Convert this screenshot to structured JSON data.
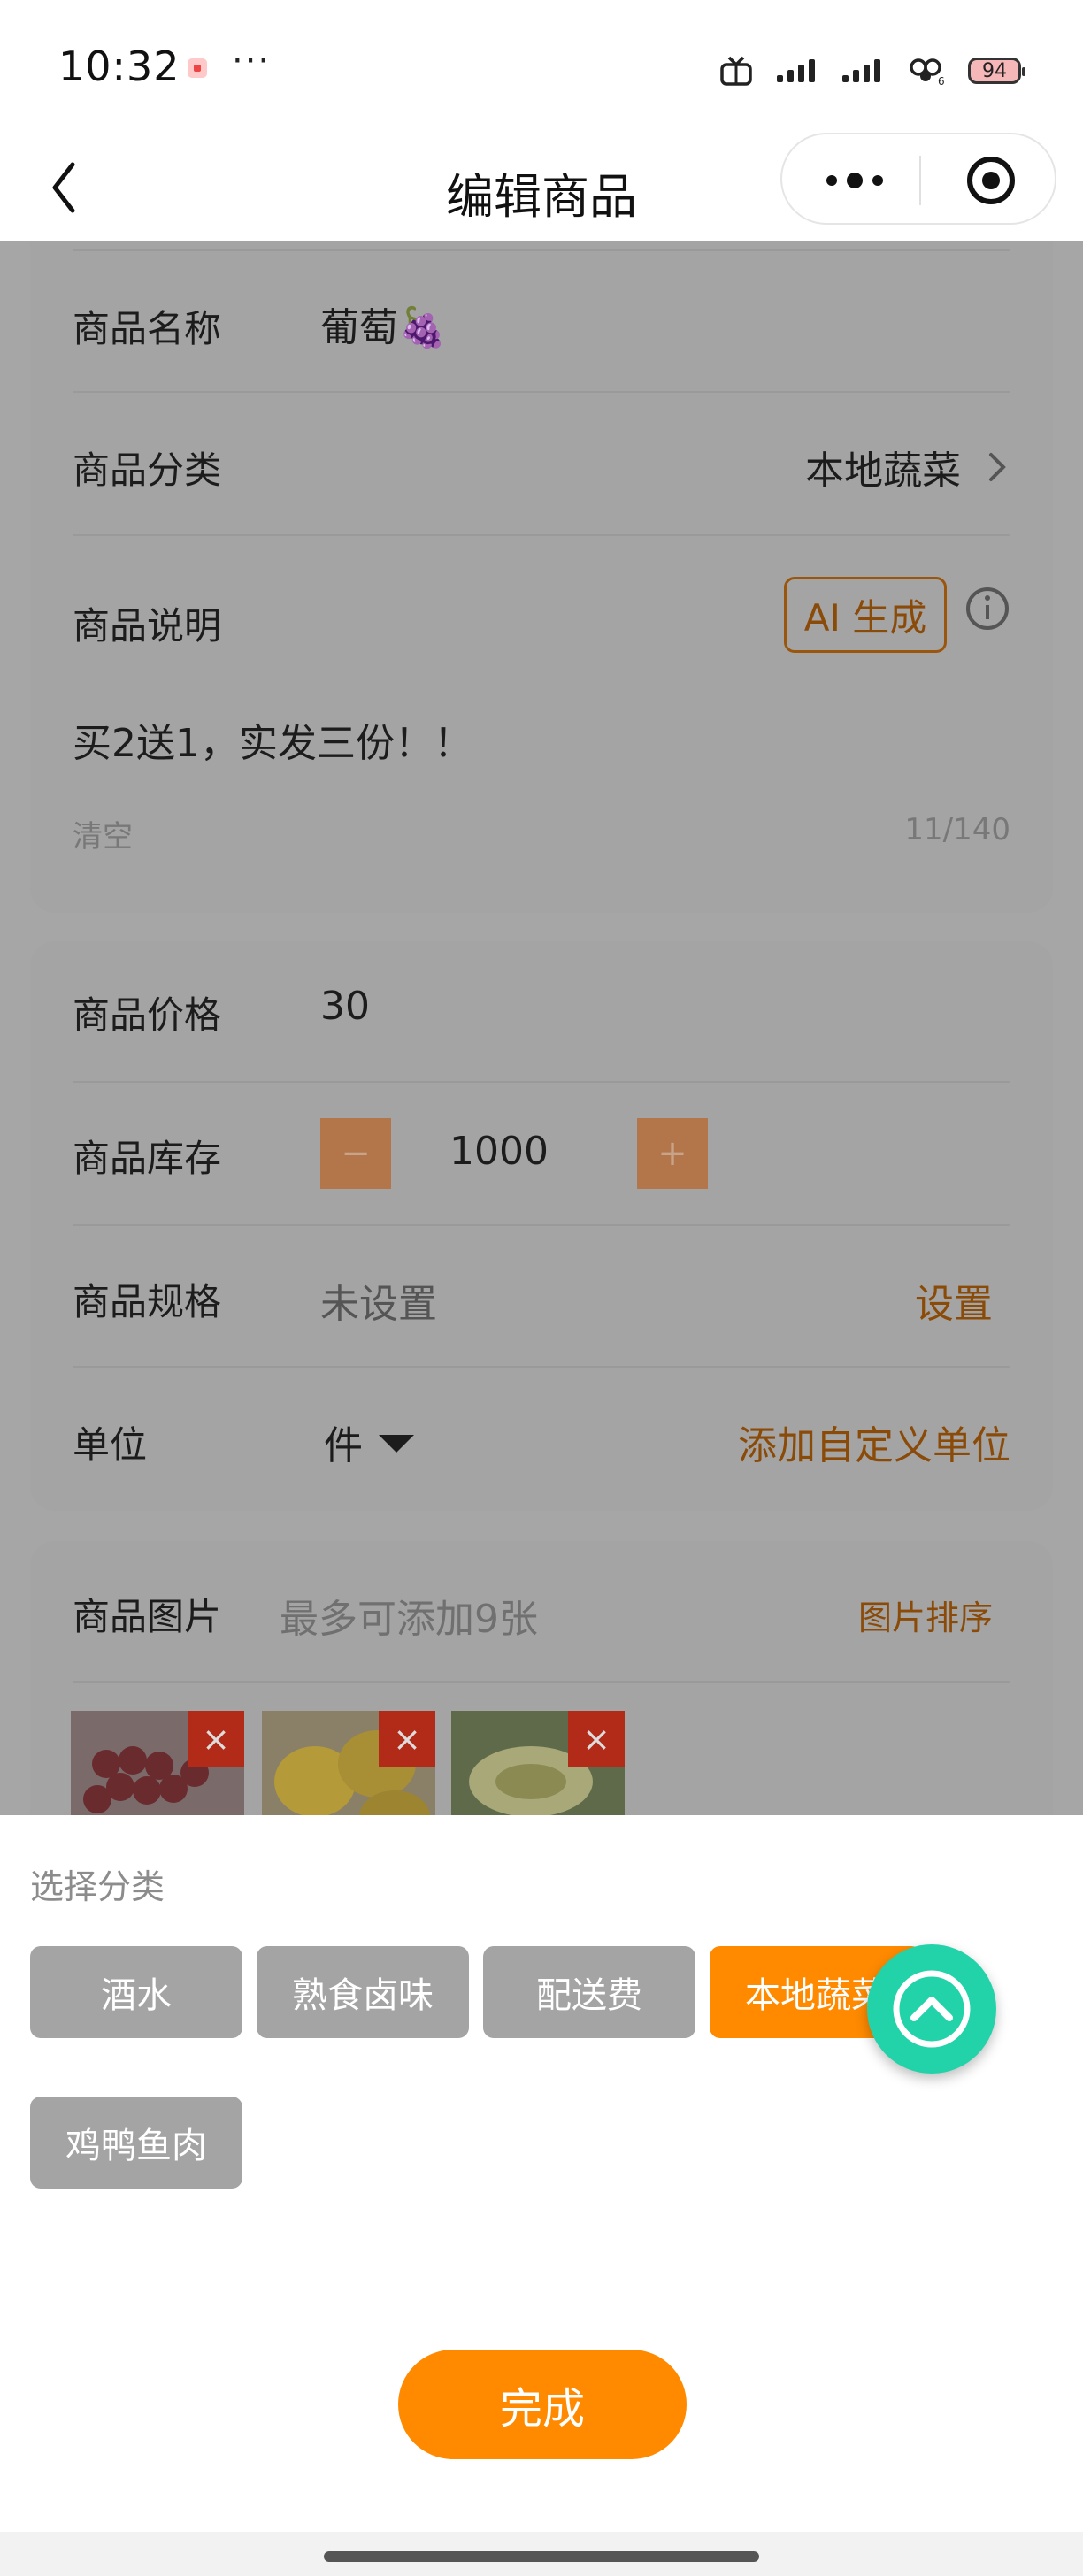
{
  "status_bar": {
    "time": "10:32",
    "more": "···",
    "battery": "94",
    "icons": [
      "app-notification-icon",
      "tv-icon",
      "signal-icon",
      "signal-icon",
      "wifi-icon",
      "battery-icon"
    ]
  },
  "nav": {
    "title": "编辑商品",
    "back_icon": "chevron-left-icon",
    "menu_icon": "more-dots-icon",
    "close_icon": "target-icon"
  },
  "basic": {
    "name_label": "商品名称",
    "name_value": "葡萄🍇",
    "category_label": "商品分类",
    "category_value": "本地蔬菜",
    "desc_label": "商品说明",
    "ai_button": "AI 生成",
    "desc_text": "买2送1，实发三份！！",
    "clear_label": "清空",
    "char_count": "11/140"
  },
  "pricing": {
    "price_label": "商品价格",
    "price_value": "30",
    "stock_label": "商品库存",
    "stock_minus": "−",
    "stock_value": "1000",
    "stock_plus": "+",
    "spec_label": "商品规格",
    "spec_value": "未设置",
    "spec_action": "设置",
    "unit_label": "单位",
    "unit_value": "件",
    "unit_action": "添加自定义单位"
  },
  "images": {
    "label": "商品图片",
    "hint": "最多可添加9张",
    "sort_action": "图片排序",
    "remove_icon": "×",
    "thumbs": [
      "grapes",
      "lemons",
      "melon"
    ]
  },
  "category_sheet": {
    "title": "选择分类",
    "options": [
      "酒水",
      "熟食卤味",
      "配送费",
      "本地蔬菜",
      "鸡鸭鱼肉"
    ],
    "selected": "本地蔬菜",
    "done_button": "完成"
  },
  "colors": {
    "accent": "#ff8a00",
    "fab": "#22d3a9",
    "chip": "#a4a4a4"
  }
}
